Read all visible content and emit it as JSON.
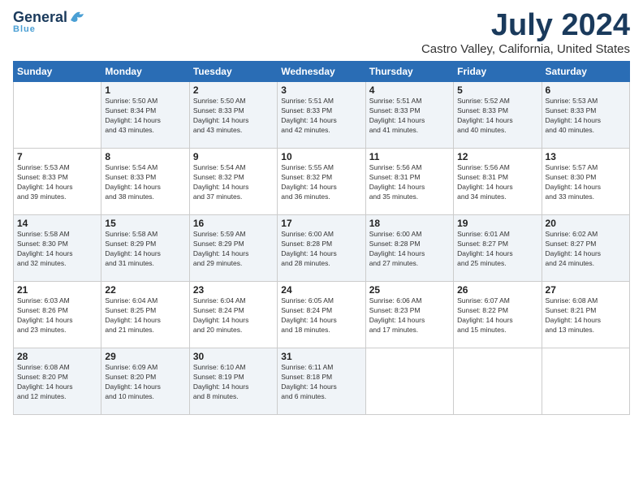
{
  "logo": {
    "general": "General",
    "blue": "Blue",
    "bird_symbol": "▲"
  },
  "header": {
    "month_year": "July 2024",
    "location": "Castro Valley, California, United States"
  },
  "weekdays": [
    "Sunday",
    "Monday",
    "Tuesday",
    "Wednesday",
    "Thursday",
    "Friday",
    "Saturday"
  ],
  "weeks": [
    [
      {
        "day": "",
        "info": ""
      },
      {
        "day": "1",
        "info": "Sunrise: 5:50 AM\nSunset: 8:34 PM\nDaylight: 14 hours\nand 43 minutes."
      },
      {
        "day": "2",
        "info": "Sunrise: 5:50 AM\nSunset: 8:33 PM\nDaylight: 14 hours\nand 43 minutes."
      },
      {
        "day": "3",
        "info": "Sunrise: 5:51 AM\nSunset: 8:33 PM\nDaylight: 14 hours\nand 42 minutes."
      },
      {
        "day": "4",
        "info": "Sunrise: 5:51 AM\nSunset: 8:33 PM\nDaylight: 14 hours\nand 41 minutes."
      },
      {
        "day": "5",
        "info": "Sunrise: 5:52 AM\nSunset: 8:33 PM\nDaylight: 14 hours\nand 40 minutes."
      },
      {
        "day": "6",
        "info": "Sunrise: 5:53 AM\nSunset: 8:33 PM\nDaylight: 14 hours\nand 40 minutes."
      }
    ],
    [
      {
        "day": "7",
        "info": "Sunrise: 5:53 AM\nSunset: 8:33 PM\nDaylight: 14 hours\nand 39 minutes."
      },
      {
        "day": "8",
        "info": "Sunrise: 5:54 AM\nSunset: 8:33 PM\nDaylight: 14 hours\nand 38 minutes."
      },
      {
        "day": "9",
        "info": "Sunrise: 5:54 AM\nSunset: 8:32 PM\nDaylight: 14 hours\nand 37 minutes."
      },
      {
        "day": "10",
        "info": "Sunrise: 5:55 AM\nSunset: 8:32 PM\nDaylight: 14 hours\nand 36 minutes."
      },
      {
        "day": "11",
        "info": "Sunrise: 5:56 AM\nSunset: 8:31 PM\nDaylight: 14 hours\nand 35 minutes."
      },
      {
        "day": "12",
        "info": "Sunrise: 5:56 AM\nSunset: 8:31 PM\nDaylight: 14 hours\nand 34 minutes."
      },
      {
        "day": "13",
        "info": "Sunrise: 5:57 AM\nSunset: 8:30 PM\nDaylight: 14 hours\nand 33 minutes."
      }
    ],
    [
      {
        "day": "14",
        "info": "Sunrise: 5:58 AM\nSunset: 8:30 PM\nDaylight: 14 hours\nand 32 minutes."
      },
      {
        "day": "15",
        "info": "Sunrise: 5:58 AM\nSunset: 8:29 PM\nDaylight: 14 hours\nand 31 minutes."
      },
      {
        "day": "16",
        "info": "Sunrise: 5:59 AM\nSunset: 8:29 PM\nDaylight: 14 hours\nand 29 minutes."
      },
      {
        "day": "17",
        "info": "Sunrise: 6:00 AM\nSunset: 8:28 PM\nDaylight: 14 hours\nand 28 minutes."
      },
      {
        "day": "18",
        "info": "Sunrise: 6:00 AM\nSunset: 8:28 PM\nDaylight: 14 hours\nand 27 minutes."
      },
      {
        "day": "19",
        "info": "Sunrise: 6:01 AM\nSunset: 8:27 PM\nDaylight: 14 hours\nand 25 minutes."
      },
      {
        "day": "20",
        "info": "Sunrise: 6:02 AM\nSunset: 8:27 PM\nDaylight: 14 hours\nand 24 minutes."
      }
    ],
    [
      {
        "day": "21",
        "info": "Sunrise: 6:03 AM\nSunset: 8:26 PM\nDaylight: 14 hours\nand 23 minutes."
      },
      {
        "day": "22",
        "info": "Sunrise: 6:04 AM\nSunset: 8:25 PM\nDaylight: 14 hours\nand 21 minutes."
      },
      {
        "day": "23",
        "info": "Sunrise: 6:04 AM\nSunset: 8:24 PM\nDaylight: 14 hours\nand 20 minutes."
      },
      {
        "day": "24",
        "info": "Sunrise: 6:05 AM\nSunset: 8:24 PM\nDaylight: 14 hours\nand 18 minutes."
      },
      {
        "day": "25",
        "info": "Sunrise: 6:06 AM\nSunset: 8:23 PM\nDaylight: 14 hours\nand 17 minutes."
      },
      {
        "day": "26",
        "info": "Sunrise: 6:07 AM\nSunset: 8:22 PM\nDaylight: 14 hours\nand 15 minutes."
      },
      {
        "day": "27",
        "info": "Sunrise: 6:08 AM\nSunset: 8:21 PM\nDaylight: 14 hours\nand 13 minutes."
      }
    ],
    [
      {
        "day": "28",
        "info": "Sunrise: 6:08 AM\nSunset: 8:20 PM\nDaylight: 14 hours\nand 12 minutes."
      },
      {
        "day": "29",
        "info": "Sunrise: 6:09 AM\nSunset: 8:20 PM\nDaylight: 14 hours\nand 10 minutes."
      },
      {
        "day": "30",
        "info": "Sunrise: 6:10 AM\nSunset: 8:19 PM\nDaylight: 14 hours\nand 8 minutes."
      },
      {
        "day": "31",
        "info": "Sunrise: 6:11 AM\nSunset: 8:18 PM\nDaylight: 14 hours\nand 6 minutes."
      },
      {
        "day": "",
        "info": ""
      },
      {
        "day": "",
        "info": ""
      },
      {
        "day": "",
        "info": ""
      }
    ]
  ]
}
